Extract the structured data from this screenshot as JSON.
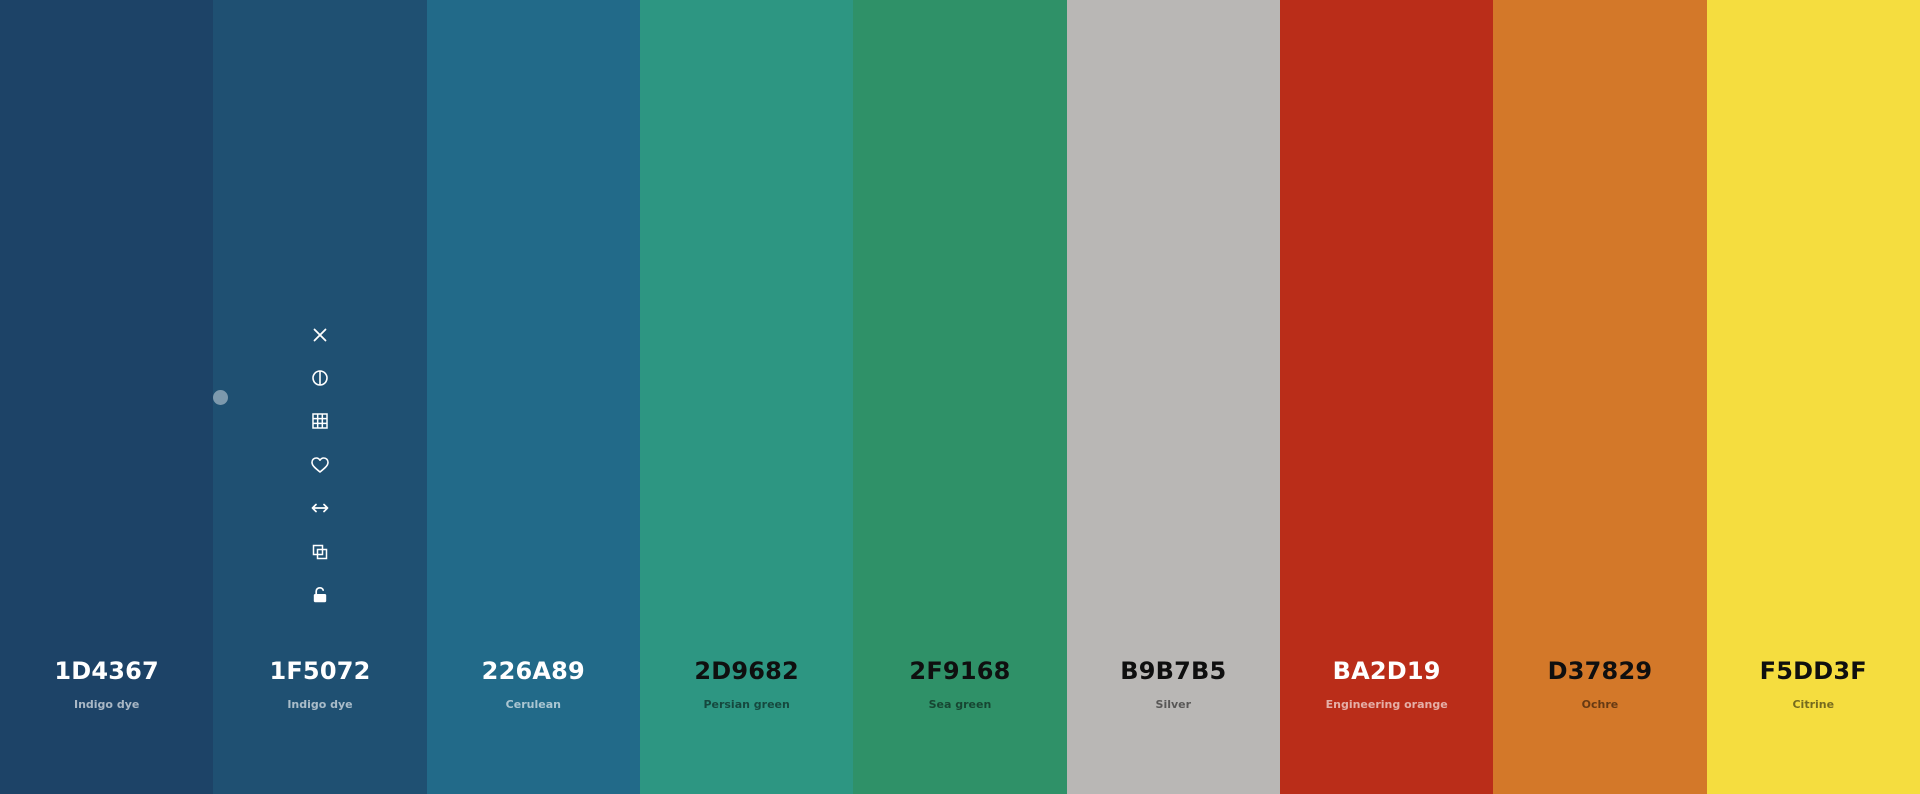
{
  "palette": {
    "colors": [
      {
        "hex": "1D4367",
        "name": "Indigo dye",
        "color": "#1D4367",
        "text_theme": "light"
      },
      {
        "hex": "1F5072",
        "name": "Indigo dye",
        "color": "#1F5072",
        "text_theme": "light"
      },
      {
        "hex": "226A89",
        "name": "Cerulean",
        "color": "#226A89",
        "text_theme": "light"
      },
      {
        "hex": "2D9682",
        "name": "Persian green",
        "color": "#2D9682",
        "text_theme": "dark"
      },
      {
        "hex": "2F9168",
        "name": "Sea green",
        "color": "#2F9168",
        "text_theme": "dark"
      },
      {
        "hex": "B9B7B5",
        "name": "Silver",
        "color": "#B9B7B5",
        "text_theme": "dark"
      },
      {
        "hex": "BA2D19",
        "name": "Engineering orange",
        "color": "#BA2D19",
        "text_theme": "light"
      },
      {
        "hex": "D37829",
        "name": "Ochre",
        "color": "#D37829",
        "text_theme": "dark"
      },
      {
        "hex": "F5DD3F",
        "name": "Citrine",
        "color": "#F5DD3F",
        "text_theme": "dark"
      }
    ],
    "hovered_swatch_toolbar": {
      "swatch": "1F5072",
      "icons": [
        "close-icon",
        "contrast-icon",
        "shades-grid-icon",
        "heart-icon",
        "drag-arrows-icon",
        "copy-icon",
        "unlock-icon"
      ]
    },
    "resize_handle": {
      "between": [
        "1D4367",
        "1F5072"
      ]
    }
  }
}
